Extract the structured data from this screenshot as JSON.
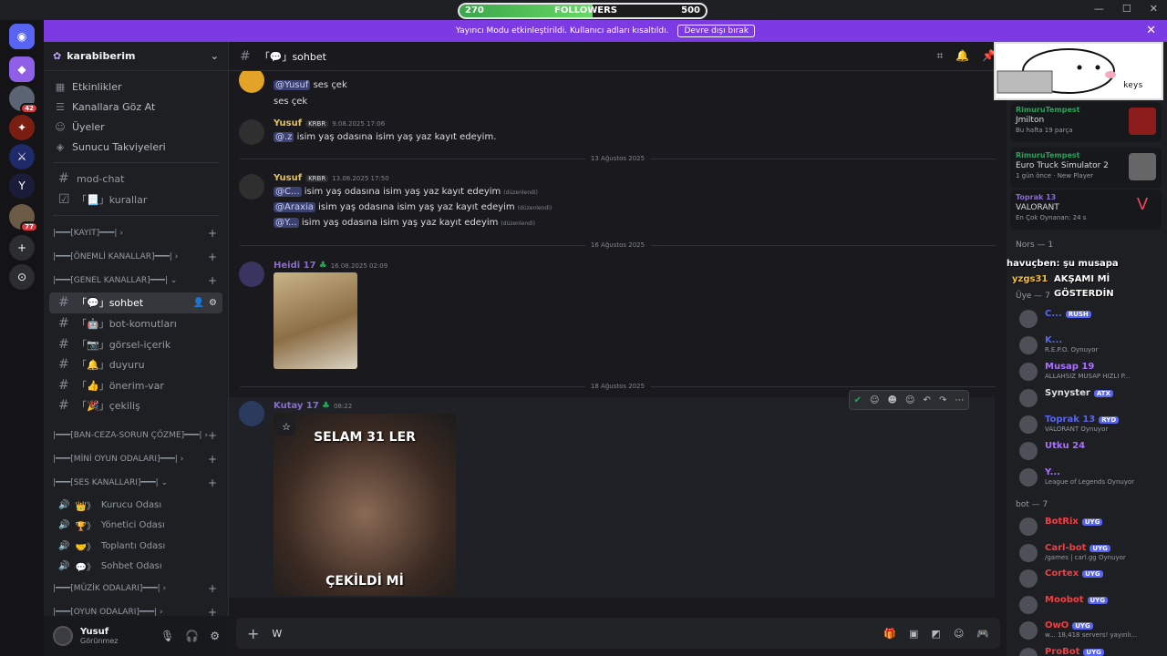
{
  "followers": {
    "current": "270",
    "label": "FOLLOWERS",
    "goal": "500",
    "fraction": 0.54
  },
  "banner": {
    "text": "Yayıncı Modu etkinleştirildi. Kullanıcı adları kısaltıldı.",
    "button": "Devre dışı bırak"
  },
  "rail": {
    "badge1": "42",
    "badge2": "77"
  },
  "server": {
    "name": "karabiberim"
  },
  "nav": [
    "Etkinlikler",
    "Kanallara Göz At",
    "Üyeler",
    "Sunucu Takviyeleri"
  ],
  "top_channels": [
    "mod-chat",
    "kurallar"
  ],
  "categories": {
    "kayit": "|━━━[KAYIT]━━━|",
    "onemli": "|━━━[ÖNEMLİ KANALLAR]━━━|",
    "genel": "|━━━[GENEL KANALLAR]━━━|",
    "ban": "|━━━[BAN-CEZA-SORUN ÇÖZME]━━━|",
    "mini": "|━━━[MİNİ OYUN ODALARI]━━━|",
    "ses": "|━━━[SES KANALLARI]━━━|",
    "muzik": "|━━━[MÜZİK ODALARI]━━━|",
    "oyun": "|━━━[OYUN ODALARI]━━━|"
  },
  "channels": [
    "sohbet",
    "bot-komutları",
    "görsel-içerik",
    "duyuru",
    "önerim-var",
    "çekiliş"
  ],
  "voice": [
    "Kurucu Odası",
    "Yönetici Odası",
    "Toplantı Odası",
    "Sohbet Odası"
  ],
  "user": {
    "name": "Yusuf",
    "status": "Görünmez"
  },
  "chat": {
    "channel": "sohbet",
    "messages": {
      "m0_line1": "ses çek",
      "m0_mention": "@Yusuf",
      "m0_line2": "ses çek",
      "m1_author": "Yusuf",
      "m1_tag": "KRBR",
      "m1_time": "9.08.2025 17:06",
      "m1_mention": "@.z",
      "m1_text": "isim yaş odasına isim yaş yaz kayıt edeyim.",
      "d1": "13 Ağustos 2025",
      "m2_author": "Yusuf",
      "m2_tag": "KRBR",
      "m2_time": "13.08.2025 17:50",
      "m2_l1_mention": "@C...",
      "m2_l1_text": "isim yaş odasına isim yaş yaz kayıt edeyim",
      "m2_l2_mention": "@Araxia",
      "m2_l2_text": "isim yaş odasına isim yaş yaz kayıt edeyim",
      "m2_l3_mention": "@Y...",
      "m2_l3_text": "isim yaş odasına isim yaş yaz kayıt edeyim",
      "edited": "(düzenlendi)",
      "d2": "16 Ağustos 2025",
      "m3_author": "Heidi 17",
      "m3_time": "16.08.2025 02:09",
      "d3": "18 Ağustos 2025",
      "m4_author": "Kutay 17",
      "m4_time": "08:22",
      "meme_top": "SELAM 31 LER",
      "meme_bottom": "ÇEKİLDİ Mİ"
    },
    "input_value": "W"
  },
  "activities": [
    {
      "user": "RimuruTempest",
      "title": "Jmilton",
      "sub": "Bu hafta 19 parça"
    },
    {
      "user": "RimuruTempest",
      "title": "Euro Truck Simulator 2",
      "sub": "1 gün önce · New Player"
    },
    {
      "user": "Toprak 13",
      "title": "VALORANT",
      "sub": "En Çok Oynanan: 24 s"
    }
  ],
  "member_groups": {
    "nors": "Nors — 1",
    "uye": "Üye — 7",
    "bot": "bot — 7"
  },
  "stream_overlay": {
    "l1": "havuçben: şu musapa",
    "l2": "yzgs31",
    "l3": "AKŞAMI Mİ",
    "l4": "GÖSTERDİN"
  },
  "members": [
    {
      "name": "C...",
      "badge": "RUSH",
      "act": "",
      "color": "#5865f2"
    },
    {
      "name": "K...",
      "badge": "",
      "act": "R.E.P.O. Oynuyor",
      "color": "#5865f2"
    },
    {
      "name": "Musap 19",
      "badge": "",
      "act": "ALLAHSIZ MUSAP HIZLI P...",
      "color": "#a970ff"
    },
    {
      "name": "Synyster",
      "badge": "ATX",
      "act": "",
      "color": "#dbdee1"
    },
    {
      "name": "Toprak 13",
      "badge": "RYD",
      "act": "VALORANT Oynuyor",
      "color": "#5865f2"
    },
    {
      "name": "Utku 24",
      "badge": "",
      "act": "",
      "color": "#a970ff"
    },
    {
      "name": "Y...",
      "badge": "",
      "act": "League of Legends Oynuyor",
      "color": "#a970ff"
    }
  ],
  "bots": [
    {
      "name": "BotRix",
      "badge": "UYG",
      "act": "",
      "color": "#f23f43"
    },
    {
      "name": "Carl-bot",
      "badge": "UYG",
      "act": "/games | carl.gg Oynuyor",
      "color": "#f23f43"
    },
    {
      "name": "Cortex",
      "badge": "UYG",
      "act": "",
      "color": "#f23f43"
    },
    {
      "name": "Moobot",
      "badge": "UYG",
      "act": "",
      "color": "#f23f43"
    },
    {
      "name": "OwO",
      "badge": "UYG",
      "act": "w... 18,418 servers! yayınlı...",
      "color": "#f23f43"
    },
    {
      "name": "ProBot",
      "badge": "UYG",
      "act": "",
      "color": "#f23f43"
    }
  ]
}
